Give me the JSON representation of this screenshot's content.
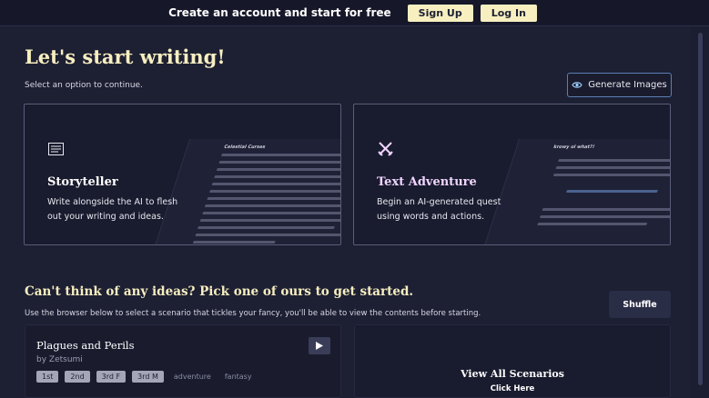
{
  "topbar": {
    "message": "Create an account and start for free",
    "signup_label": "Sign Up",
    "login_label": "Log In"
  },
  "header": {
    "title": "Let's start writing!",
    "subtitle": "Select an option to continue.",
    "generate_images_label": "Generate Images",
    "generate_images_icon": "eye-icon"
  },
  "cards": [
    {
      "title": "Storyteller",
      "description": "Write alongside the AI to flesh out your writing and ideas.",
      "icon": "document-lines-icon",
      "preview_title": "Celestial Curses"
    },
    {
      "title": "Text Adventure",
      "description": "Begin an AI-generated quest using words and actions.",
      "icon": "crossed-swords-icon",
      "preview_title": "krowy ol what?!"
    }
  ],
  "ideas": {
    "title": "Can't think of any ideas? Pick one of ours to get started.",
    "subtitle": "Use the browser below to select a scenario that tickles your fancy, you'll be able to view the contents before starting.",
    "shuffle_label": "Shuffle"
  },
  "scenario": {
    "title": "Plagues and Perils",
    "author": "by Zetsumi",
    "tags": [
      "1st",
      "2nd",
      "3rd F",
      "3rd M"
    ],
    "plain_tags": [
      "adventure",
      "fantasy"
    ]
  },
  "view_all": {
    "title": "View All Scenarios",
    "subtitle": "Click Here"
  },
  "colors": {
    "accent": "#f7efc0",
    "background": "#1d1f33",
    "button_border": "#5c7fb5"
  }
}
